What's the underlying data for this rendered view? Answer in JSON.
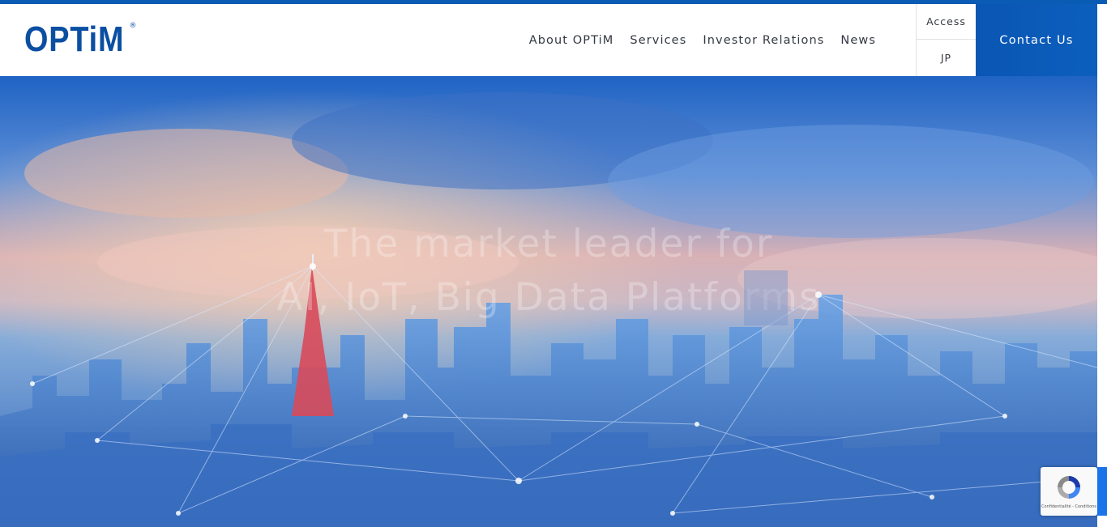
{
  "brand": {
    "logo_text": "OPTiM",
    "logo_mark": "®",
    "color": "#0b4fa2"
  },
  "nav": {
    "items": [
      {
        "label": "About OPTiM"
      },
      {
        "label": "Services"
      },
      {
        "label": "Investor Relations"
      },
      {
        "label": "News"
      }
    ]
  },
  "utility": {
    "access_label": "Access",
    "lang_label": "JP"
  },
  "contact": {
    "label": "Contact Us",
    "color": "#0a56b4"
  },
  "hero": {
    "headline_line1": "The market leader for",
    "headline_line2": "AI, IoT, Big Data Platforms",
    "image": "tokyo-skyline-network-photo"
  },
  "recaptcha": {
    "icon": "recaptcha-icon",
    "text": "Confidentialité - Conditions"
  }
}
